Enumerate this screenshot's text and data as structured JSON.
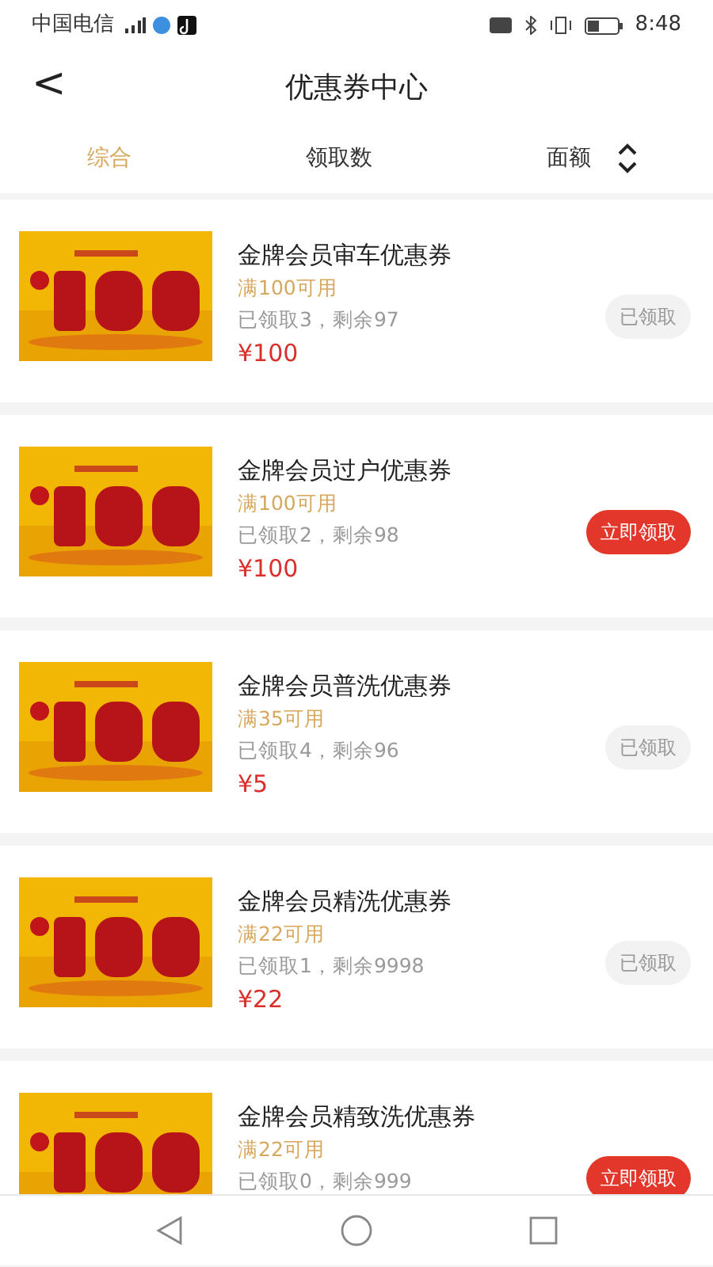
{
  "status_bar": {
    "carrier": "中国电信",
    "time": "8:48"
  },
  "header": {
    "back": "<",
    "title": "优惠券中心"
  },
  "sort_tabs": [
    {
      "label": "综合",
      "selected": true,
      "sortable": false
    },
    {
      "label": "领取数",
      "selected": false,
      "sortable": false
    },
    {
      "label": "面额",
      "selected": false,
      "sortable": true
    }
  ],
  "coupons": [
    {
      "name": "金牌会员审车优惠券",
      "condition": "满100可用",
      "stats": "已领取3，剩余97",
      "price": "¥100",
      "button": "已领取",
      "claimed": true
    },
    {
      "name": "金牌会员过户优惠券",
      "condition": "满100可用",
      "stats": "已领取2，剩余98",
      "price": "¥100",
      "button": "立即领取",
      "claimed": false
    },
    {
      "name": "金牌会员普洗优惠券",
      "condition": "满35可用",
      "stats": "已领取4，剩余96",
      "price": "¥5",
      "button": "已领取",
      "claimed": true
    },
    {
      "name": "金牌会员精洗优惠券",
      "condition": "满22可用",
      "stats": "已领取1，剩余9998",
      "price": "¥22",
      "button": "已领取",
      "claimed": true
    },
    {
      "name": "金牌会员精致洗优惠券",
      "condition": "满22可用",
      "stats": "已领取0，剩余999",
      "button": "立即领取",
      "claimed": false
    }
  ]
}
